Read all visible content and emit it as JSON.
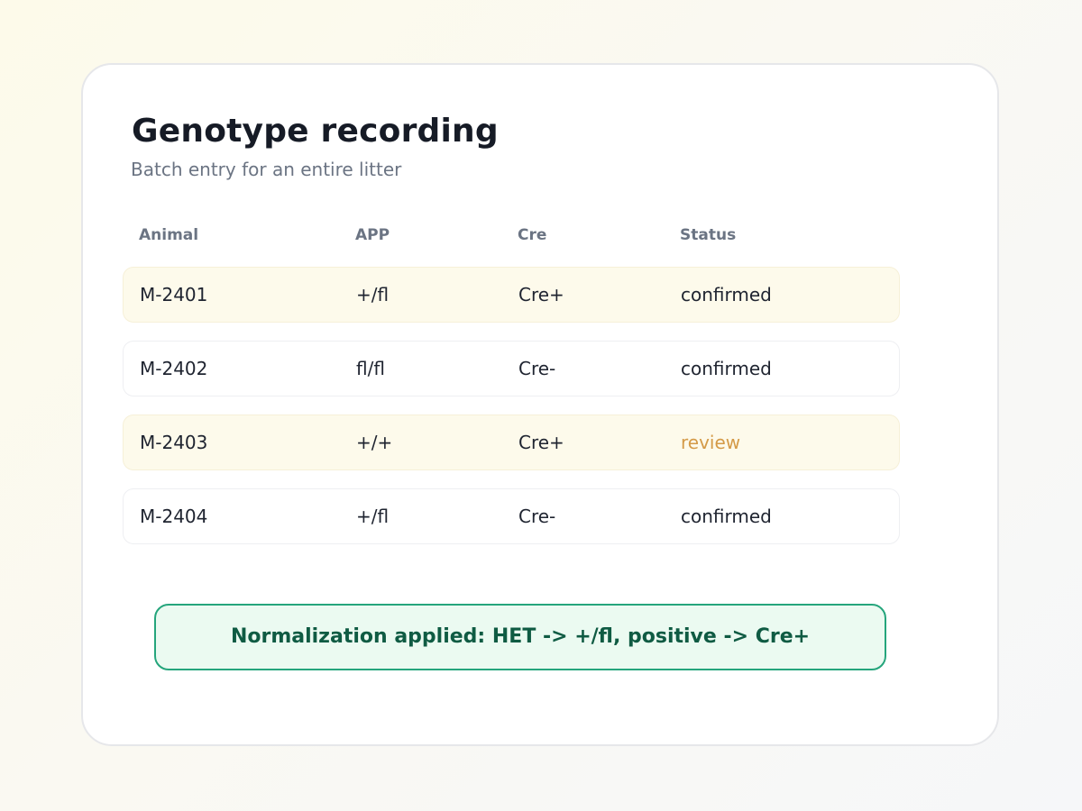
{
  "page": {
    "title": "Genotype recording",
    "subtitle": "Batch entry for an entire litter"
  },
  "table": {
    "columns": [
      "Animal",
      "APP",
      "Cre",
      "Status"
    ],
    "rows": [
      {
        "animal": "M-2401",
        "app": "+/fl",
        "cre": "Cre+",
        "status": "confirmed"
      },
      {
        "animal": "M-2402",
        "app": "fl/fl",
        "cre": "Cre-",
        "status": "confirmed"
      },
      {
        "animal": "M-2403",
        "app": "+/+",
        "cre": "Cre+",
        "status": "review"
      },
      {
        "animal": "M-2404",
        "app": "+/fl",
        "cre": "Cre-",
        "status": "confirmed"
      }
    ]
  },
  "notice": {
    "text": "Normalization applied: HET -> +/fl, positive -> Cre+"
  },
  "colors": {
    "accent": "#25a57c",
    "notice_text": "#0f5b43",
    "notice_bg": "#ebfaf1",
    "review_status": "#d49a47",
    "tinted_row_bg": "#fdfaeb"
  }
}
